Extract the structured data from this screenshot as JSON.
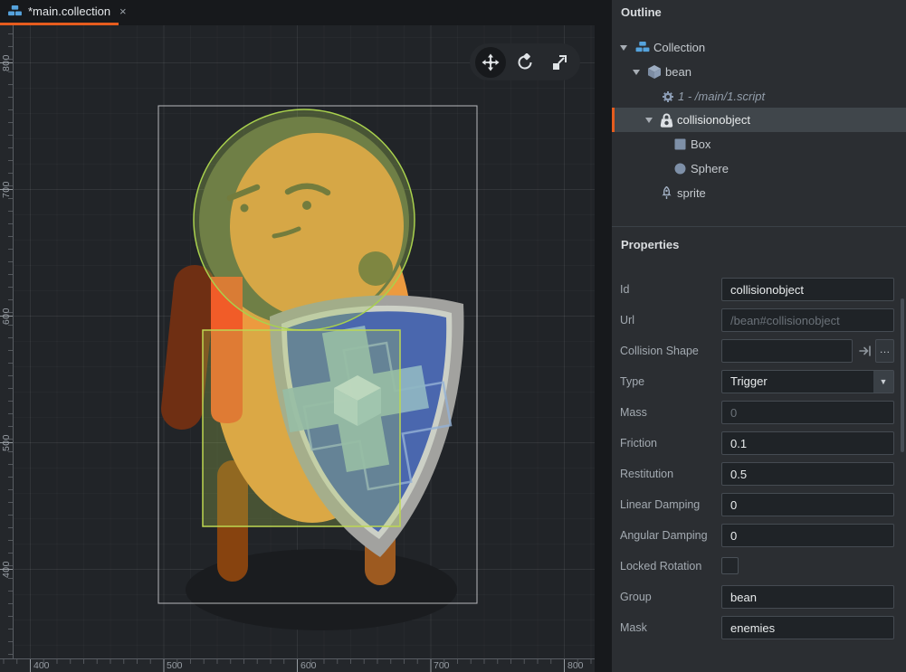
{
  "tab": {
    "title": "*main.collection",
    "icon": "collection-icon"
  },
  "icons": {
    "tab_close": "×",
    "dropdown_caret": "▼",
    "ellipsis_button": "…"
  },
  "colors": {
    "accent_orange": "#e65c1e",
    "panel_bg": "#2b2e32",
    "viewport_bg": "#212428",
    "collection_icon_blue": "#55a3dd",
    "shield_blue": "#4a67ae",
    "bean_orange": "#ec9a3f",
    "collision_overlay_green": "#a9d14d"
  },
  "outline": {
    "header": "Outline",
    "items": [
      {
        "label": "Collection",
        "icon": "collection-icon",
        "expanded": true
      },
      {
        "label": "bean",
        "icon": "game-object-icon",
        "expanded": true
      },
      {
        "label": "1 - /main/1.script",
        "icon": "script-icon"
      },
      {
        "label": "collisionobject",
        "icon": "collision-object-icon",
        "expanded": true,
        "selected": true
      },
      {
        "label": "Box",
        "icon": "box-shape-icon"
      },
      {
        "label": "Sphere",
        "icon": "sphere-shape-icon"
      },
      {
        "label": "sprite",
        "icon": "sprite-icon"
      }
    ]
  },
  "properties": {
    "header": "Properties",
    "fields": [
      {
        "label": "Id",
        "value": "collisionobject",
        "type": "text"
      },
      {
        "label": "Url",
        "value": "/bean#collisionobject",
        "type": "text-readonly"
      },
      {
        "label": "Collision Shape",
        "value": "",
        "type": "resource"
      },
      {
        "label": "Type",
        "value": "Trigger",
        "type": "dropdown"
      },
      {
        "label": "Mass",
        "value": "0",
        "type": "text-disabled"
      },
      {
        "label": "Friction",
        "value": "0.1",
        "type": "text"
      },
      {
        "label": "Restitution",
        "value": "0.5",
        "type": "text"
      },
      {
        "label": "Linear Damping",
        "value": "0",
        "type": "text"
      },
      {
        "label": "Angular Damping",
        "value": "0",
        "type": "text"
      },
      {
        "label": "Locked Rotation",
        "checked": false,
        "type": "checkbox"
      },
      {
        "label": "Group",
        "value": "bean",
        "type": "text"
      },
      {
        "label": "Mask",
        "value": "enemies",
        "type": "text"
      }
    ]
  },
  "viewport": {
    "toolbar": [
      "move-tool",
      "rotate-tool",
      "scale-tool"
    ],
    "active_tool": "move-tool",
    "rulers": {
      "left": [
        "800",
        "700",
        "600",
        "500",
        "400"
      ],
      "bottom": [
        "400",
        "500",
        "600",
        "700",
        "800"
      ]
    },
    "scene": {
      "selected_object": "collisionobject",
      "shapes": [
        "Sphere",
        "Box"
      ]
    }
  }
}
